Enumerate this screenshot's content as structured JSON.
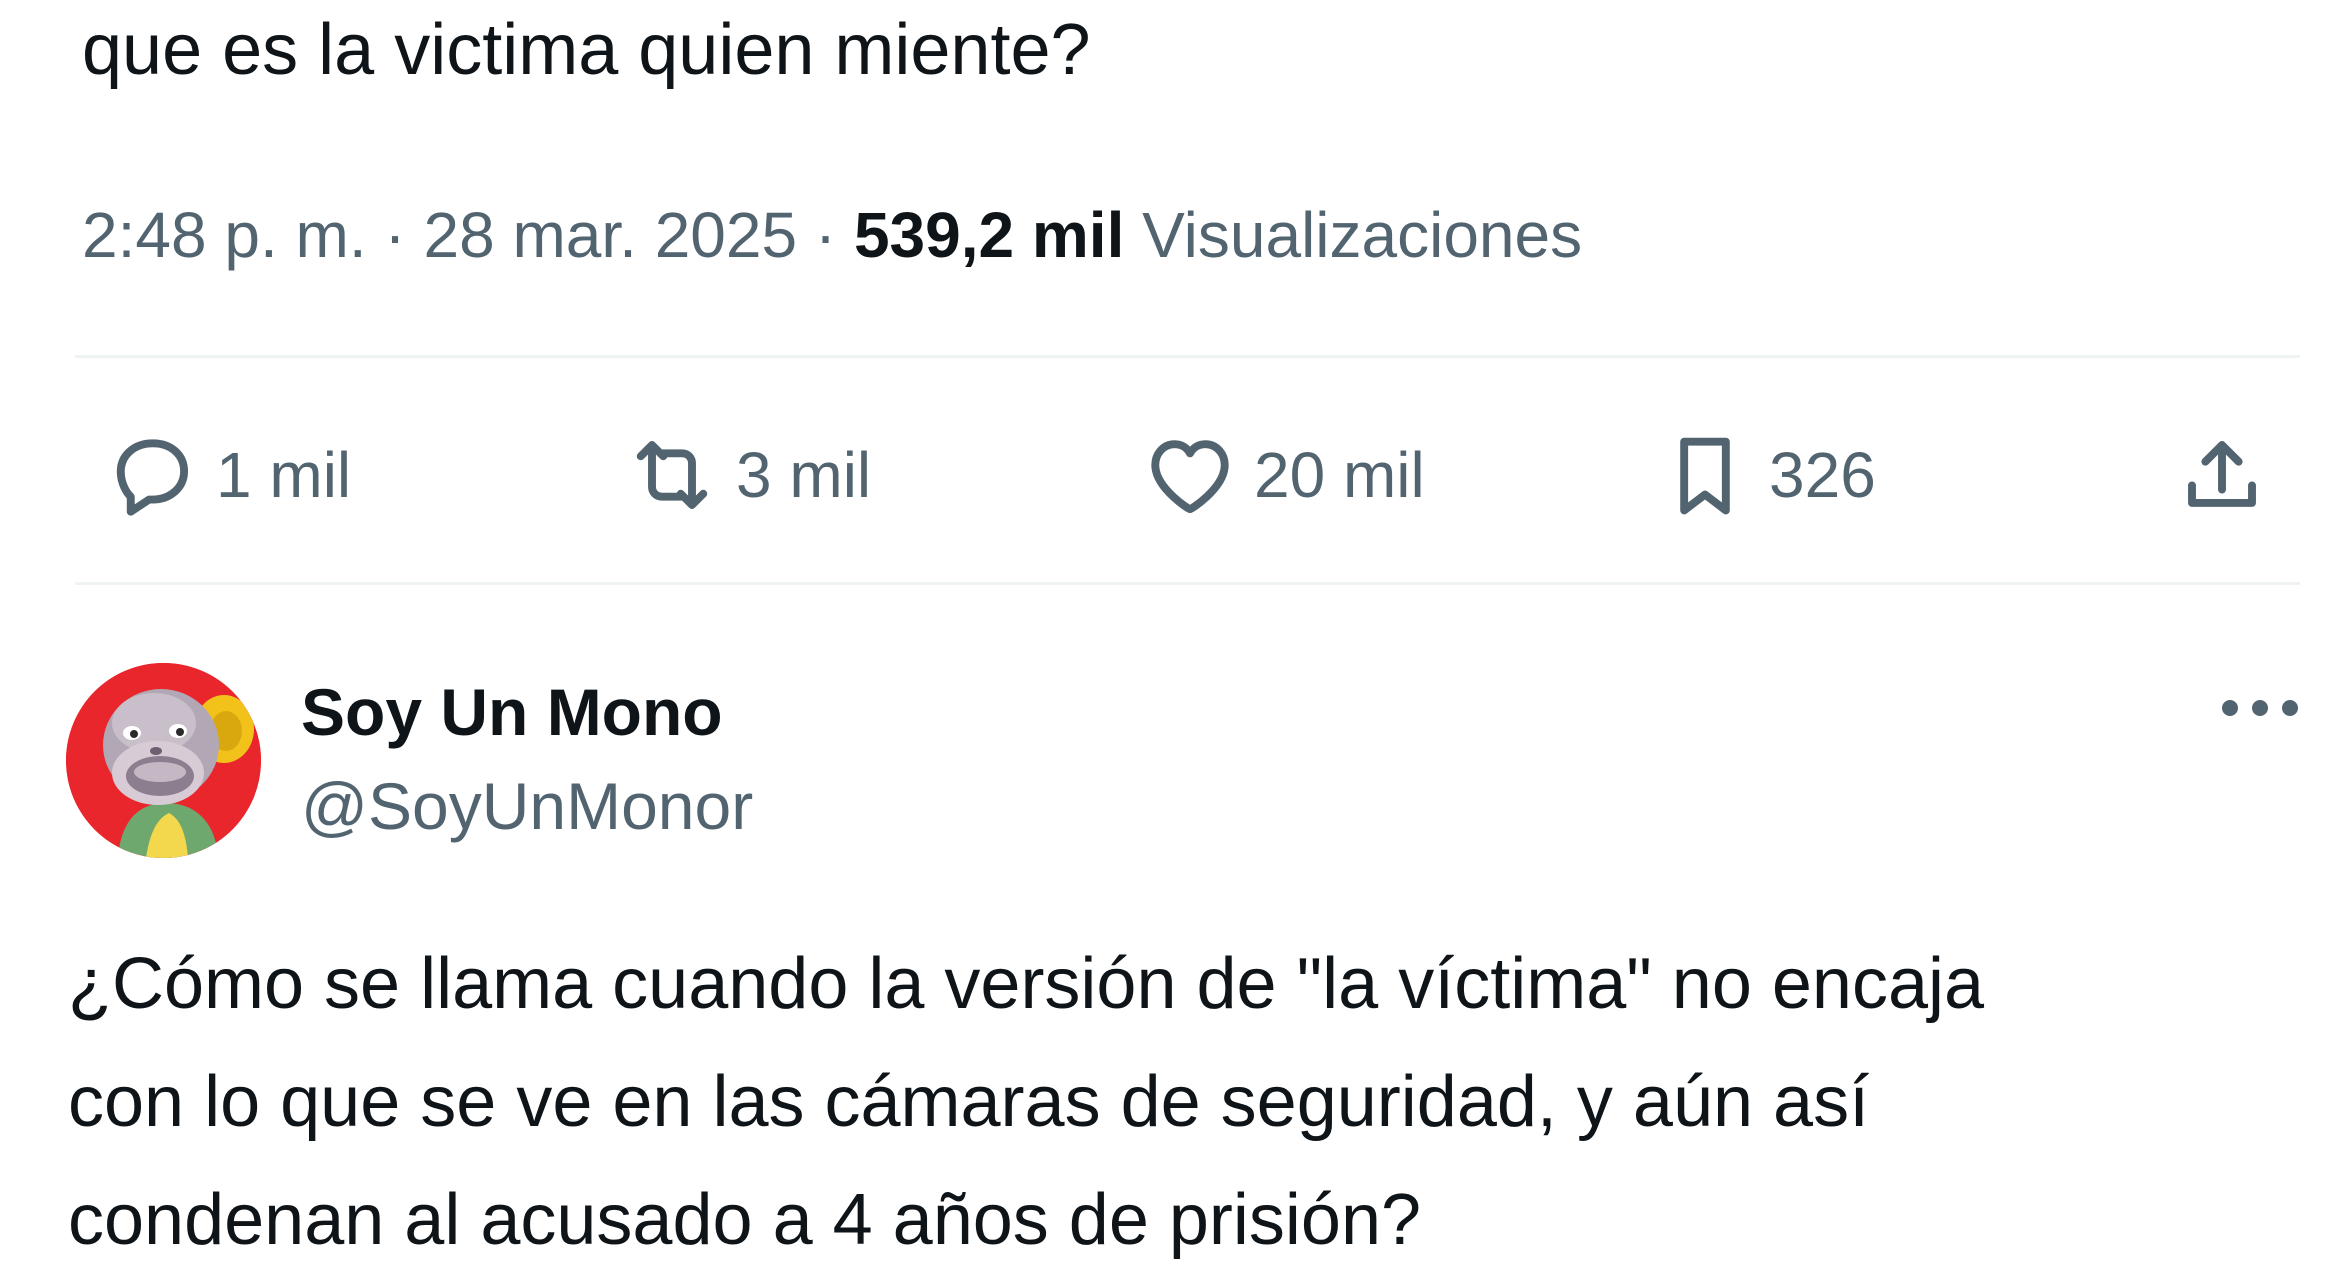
{
  "tweet": {
    "text_tail": "que es la victima quien miente?",
    "timestamp": "2:48 p. m. · 28 mar. 2025 · ",
    "views_count": "539,2 mil",
    "views_label": "Visualizaciones",
    "actions": {
      "reply_icon": "comment-bubble-icon",
      "reply_count": "1 mil",
      "retweet_icon": "retweet-icon",
      "retweet_count": "3 mil",
      "like_icon": "heart-icon",
      "like_count": "20 mil",
      "bookmark_icon": "bookmark-icon",
      "bookmark_count": "326",
      "share_icon": "share-upload-icon"
    }
  },
  "reply": {
    "display_name": "Soy Un Mono",
    "handle": "@SoyUnMonor",
    "avatar": "monkey-puppet-avatar",
    "text_lines": [
      "¿Cómo se llama cuando la versión de \"la víctima\" no encaja",
      "con lo que se ve en las cámaras de seguridad, y aún así",
      "condenan al acusado a 4 años de prisión?"
    ]
  },
  "colors": {
    "text_primary": "#0f1419",
    "text_secondary": "#536471",
    "divider": "#eff3f4",
    "avatar_bg": "#e8262b"
  }
}
